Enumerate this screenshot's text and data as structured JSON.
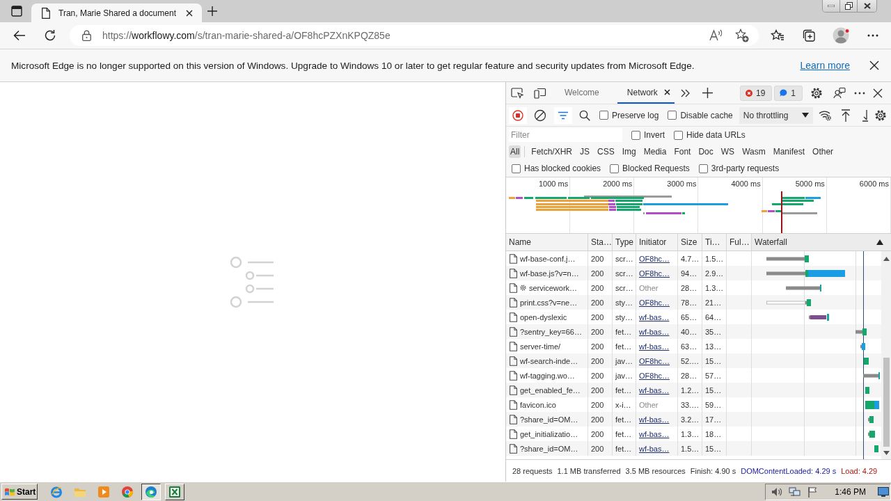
{
  "browser": {
    "tab_title": "Tran, Marie Shared a document",
    "url": {
      "scheme": "https://",
      "host": "workflowy.com",
      "path": "/s/tran-marie-shared-a/OF8hcPZXnKPQZ85e"
    }
  },
  "infobar": {
    "message": "Microsoft Edge is no longer supported on this version of Windows. Upgrade to Windows 10 or later to get regular feature and security updates from Microsoft Edge.",
    "link": "Learn more"
  },
  "devtools": {
    "tabs": [
      {
        "label": "Welcome",
        "selected": false,
        "closable": false
      },
      {
        "label": "Network",
        "selected": true,
        "closable": true
      }
    ],
    "issues": [
      {
        "kind": "error",
        "count": "19"
      },
      {
        "kind": "info",
        "count": "1"
      }
    ],
    "recording": true,
    "filter_bar_open": true,
    "toolbar_checkboxes": [
      {
        "label": "Preserve log",
        "checked": false
      },
      {
        "label": "Disable cache",
        "checked": false
      }
    ],
    "throttling": "No throttling",
    "filter": {
      "placeholder": "Filter"
    },
    "filter_checkboxes": [
      {
        "label": "Invert",
        "checked": false
      },
      {
        "label": "Hide data URLs",
        "checked": false
      }
    ],
    "type_filters": [
      {
        "label": "All",
        "selected": true
      },
      {
        "label": "Fetch/XHR",
        "selected": false
      },
      {
        "label": "JS",
        "selected": false
      },
      {
        "label": "CSS",
        "selected": false
      },
      {
        "label": "Img",
        "selected": false
      },
      {
        "label": "Media",
        "selected": false
      },
      {
        "label": "Font",
        "selected": false
      },
      {
        "label": "Doc",
        "selected": false
      },
      {
        "label": "WS",
        "selected": false
      },
      {
        "label": "Wasm",
        "selected": false
      },
      {
        "label": "Manifest",
        "selected": false
      },
      {
        "label": "Other",
        "selected": false
      }
    ],
    "blocking_checkboxes": [
      {
        "label": "Has blocked cookies",
        "checked": false
      },
      {
        "label": "Blocked Requests",
        "checked": false
      },
      {
        "label": "3rd-party requests",
        "checked": false
      }
    ],
    "overview_ticks": [
      "1000 ms",
      "2000 ms",
      "3000 ms",
      "4000 ms",
      "5000 ms",
      "6000 ms"
    ],
    "columns": [
      {
        "label": "Name",
        "sorted": false
      },
      {
        "label": "Sta…",
        "sorted": false
      },
      {
        "label": "Type",
        "sorted": false
      },
      {
        "label": "Initiator",
        "sorted": false
      },
      {
        "label": "Size",
        "sorted": false
      },
      {
        "label": "Ti…",
        "sorted": false
      },
      {
        "label": "Ful…",
        "sorted": false
      },
      {
        "label": "Waterfall",
        "sorted": true
      }
    ],
    "rows": [
      {
        "name": "wf-base-conf.j…",
        "service_worker": false,
        "status": "200",
        "type": "scr…",
        "initiator": "OF8hc…",
        "initiator_link": true,
        "size": "4.7…",
        "time": "1.5…"
      },
      {
        "name": "wf-base.js?v=n…",
        "service_worker": false,
        "status": "200",
        "type": "scr…",
        "initiator": "OF8hc…",
        "initiator_link": true,
        "size": "94…",
        "time": "2.9…"
      },
      {
        "name": "servicework…",
        "service_worker": true,
        "status": "200",
        "type": "scr…",
        "initiator": "Other",
        "initiator_link": false,
        "size": "28…",
        "time": "1.3…"
      },
      {
        "name": "print.css?v=ne…",
        "service_worker": false,
        "status": "200",
        "type": "sty…",
        "initiator": "OF8hc…",
        "initiator_link": true,
        "size": "78…",
        "time": "21…"
      },
      {
        "name": "open-dyslexic",
        "service_worker": false,
        "status": "200",
        "type": "sty…",
        "initiator": "wf-bas…",
        "initiator_link": true,
        "size": "65…",
        "time": "64…"
      },
      {
        "name": "?sentry_key=66…",
        "service_worker": false,
        "status": "200",
        "type": "fet…",
        "initiator": "wf-bas…",
        "initiator_link": true,
        "size": "40…",
        "time": "35…"
      },
      {
        "name": "server-time/",
        "service_worker": false,
        "status": "200",
        "type": "fet…",
        "initiator": "wf-bas…",
        "initiator_link": true,
        "size": "63…",
        "time": "13…"
      },
      {
        "name": "wf-search-inde…",
        "service_worker": false,
        "status": "200",
        "type": "jav…",
        "initiator": "OF8hc…",
        "initiator_link": true,
        "size": "52.…",
        "time": "15…"
      },
      {
        "name": "wf-tagging.wo…",
        "service_worker": false,
        "status": "200",
        "type": "jav…",
        "initiator": "OF8hc…",
        "initiator_link": true,
        "size": "28…",
        "time": "57…"
      },
      {
        "name": "get_enabled_fe…",
        "service_worker": false,
        "status": "200",
        "type": "fet…",
        "initiator": "wf-bas…",
        "initiator_link": true,
        "size": "1.2…",
        "time": "15…"
      },
      {
        "name": "favicon.ico",
        "service_worker": false,
        "status": "200",
        "type": "x-i…",
        "initiator": "Other",
        "initiator_link": false,
        "size": "33.…",
        "time": "59…"
      },
      {
        "name": "?share_id=OM…",
        "service_worker": false,
        "status": "200",
        "type": "fet…",
        "initiator": "wf-bas…",
        "initiator_link": true,
        "size": "3.2…",
        "time": "17…"
      },
      {
        "name": "get_initializatio…",
        "service_worker": false,
        "status": "200",
        "type": "fet…",
        "initiator": "wf-bas…",
        "initiator_link": true,
        "size": "1.3…",
        "time": "18…"
      },
      {
        "name": "?share_id=OM…",
        "service_worker": false,
        "status": "200",
        "type": "fet…",
        "initiator": "wf-bas…",
        "initiator_link": true,
        "size": "1.5…",
        "time": "15…"
      }
    ],
    "summary": [
      {
        "text": "28 requests",
        "kind": "plain"
      },
      {
        "text": "1.1 MB transferred",
        "kind": "plain"
      },
      {
        "text": "3.5 MB resources",
        "kind": "plain"
      },
      {
        "text": "Finish: 4.90 s",
        "kind": "plain"
      },
      {
        "text": "DOMContentLoaded: 4.29 s",
        "kind": "dom"
      },
      {
        "text": "Load: 4.29",
        "kind": "load"
      }
    ]
  },
  "taskbar": {
    "start": "Start",
    "apps": [
      {
        "kind": "ie",
        "running": false,
        "selected": false
      },
      {
        "kind": "folder",
        "running": false,
        "selected": false
      },
      {
        "kind": "media",
        "running": false,
        "selected": false
      },
      {
        "kind": "chrome",
        "running": false,
        "selected": false
      },
      {
        "kind": "edge",
        "running": true,
        "selected": true
      },
      {
        "kind": "excel",
        "running": true,
        "selected": false
      }
    ],
    "clock": "1:46 PM"
  }
}
